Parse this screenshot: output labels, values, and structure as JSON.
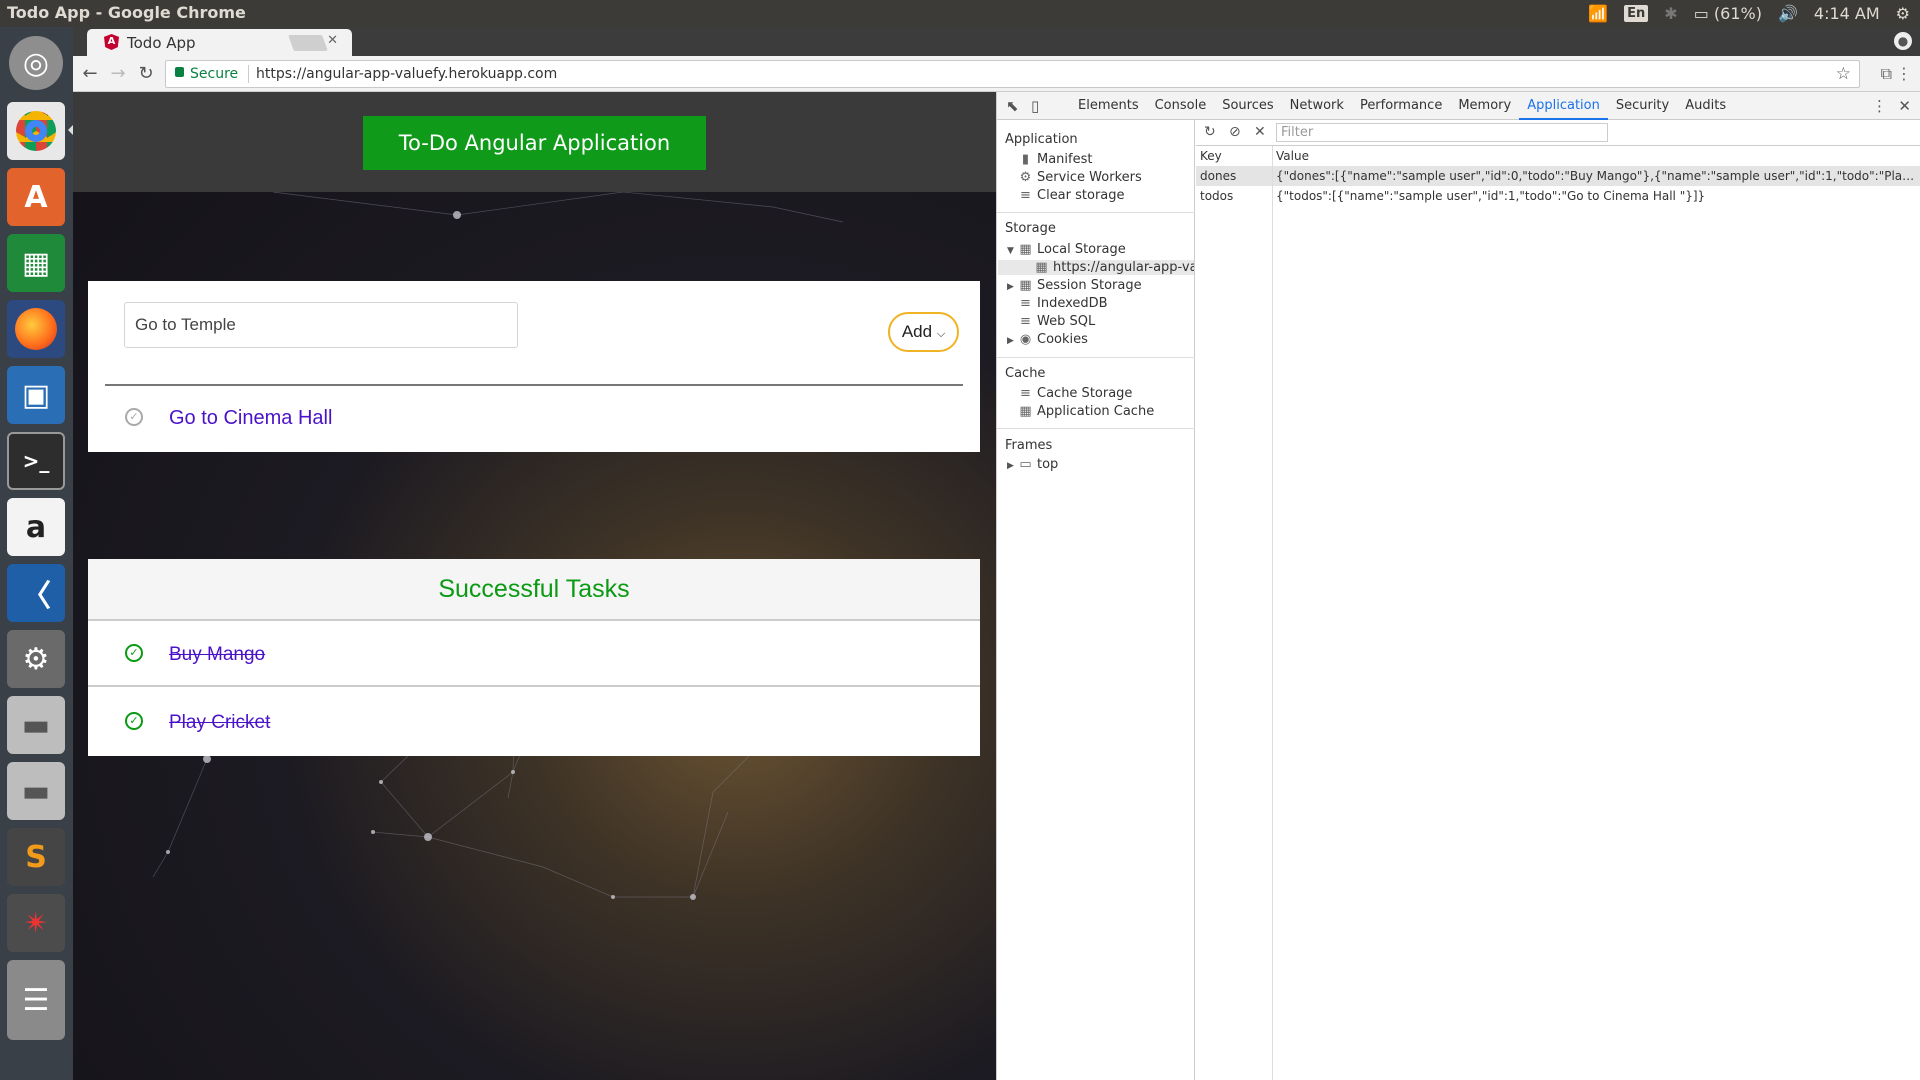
{
  "os": {
    "window_title": "Todo App - Google Chrome",
    "keyboard_layout": "En",
    "battery": "(61%)",
    "time": "4:14 AM"
  },
  "launcher": {
    "apps": [
      "ubuntu-logo-icon",
      "chrome-icon",
      "software-center-icon",
      "spreadsheet-icon",
      "firefox-icon",
      "image-viewer-icon",
      "terminal-icon",
      "amazon-icon",
      "vscode-icon",
      "settings-icon",
      "disk-icon",
      "disk2-icon",
      "sublime-icon",
      "network-icon",
      "stacked-apps-icon"
    ]
  },
  "browser": {
    "tab_title": "Todo App",
    "tab_favicon": "A",
    "secure_label": "Secure",
    "url": "https://angular-app-valuefy.herokuapp.com"
  },
  "app": {
    "brand": "To-Do Angular Application",
    "input_value": "Go to Temple",
    "add_label": "Add",
    "todos": [
      "Go to Cinema Hall"
    ],
    "done_title": "Successful Tasks",
    "dones": [
      "Buy Mango",
      "Play Cricket"
    ],
    "colors": {
      "brand": "#0f9a1a",
      "todo_text": "#4b13c9",
      "done_check": "#0a9a13",
      "add_border": "#f0b323"
    }
  },
  "devtools": {
    "tabs": [
      "Elements",
      "Console",
      "Sources",
      "Network",
      "Performance",
      "Memory",
      "Application",
      "Security",
      "Audits"
    ],
    "active_tab": "Application",
    "sidebar": {
      "application_title": "Application",
      "application_items": [
        "Manifest",
        "Service Workers",
        "Clear storage"
      ],
      "storage_title": "Storage",
      "storage_items": [
        "Local Storage",
        "https://angular-app-valu",
        "Session Storage",
        "IndexedDB",
        "Web SQL",
        "Cookies"
      ],
      "cache_title": "Cache",
      "cache_items": [
        "Cache Storage",
        "Application Cache"
      ],
      "frames_title": "Frames",
      "frames_items": [
        "top"
      ]
    },
    "filter_placeholder": "Filter",
    "table": {
      "headers": [
        "Key",
        "Value"
      ],
      "rows": [
        {
          "key": "dones",
          "value": "{\"dones\":[{\"name\":\"sample user\",\"id\":0,\"todo\":\"Buy Mango\"},{\"name\":\"sample user\",\"id\":1,\"todo\":\"Play ..."
        },
        {
          "key": "todos",
          "value": "{\"todos\":[{\"name\":\"sample user\",\"id\":1,\"todo\":\"Go to Cinema Hall \"}]}"
        }
      ]
    }
  }
}
